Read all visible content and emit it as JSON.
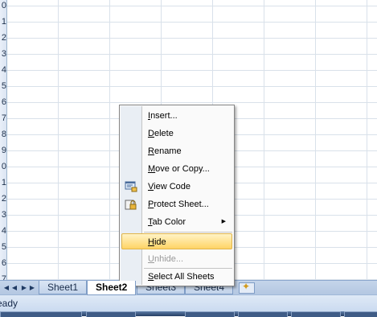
{
  "rows": [
    "0",
    "1",
    "2",
    "3",
    "4",
    "5",
    "6",
    "7",
    "8",
    "9",
    "0",
    "1",
    "2",
    "3",
    "4",
    "5",
    "6",
    "7"
  ],
  "context_menu": {
    "items": [
      {
        "pre": "",
        "u": "I",
        "post": "nsert...",
        "disabled": false
      },
      {
        "pre": "",
        "u": "D",
        "post": "elete",
        "disabled": false
      },
      {
        "pre": "",
        "u": "R",
        "post": "ename",
        "disabled": false
      },
      {
        "pre": "",
        "u": "M",
        "post": "ove or Copy...",
        "disabled": false
      },
      {
        "pre": "",
        "u": "V",
        "post": "iew Code",
        "icon": "view-code-icon",
        "disabled": false
      },
      {
        "pre": "",
        "u": "P",
        "post": "rotect Sheet...",
        "icon": "protect-sheet-icon",
        "disabled": false
      },
      {
        "pre": "",
        "u": "T",
        "post": "ab Color",
        "submenu": true,
        "disabled": false
      },
      {
        "pre": "",
        "u": "H",
        "post": "ide",
        "highlighted": true,
        "disabled": false
      },
      {
        "pre": "",
        "u": "U",
        "post": "nhide...",
        "disabled": true
      },
      {
        "pre": "",
        "u": "S",
        "post": "elect All Sheets",
        "disabled": false
      }
    ]
  },
  "sheet_tabs": {
    "nav": [
      "◀◀",
      "◀",
      "▶",
      "▶▶"
    ],
    "tabs": [
      {
        "label": "Sheet1",
        "active": false
      },
      {
        "label": "Sheet2",
        "active": true
      },
      {
        "label": "Sheet3",
        "active": false
      },
      {
        "label": "Sheet4",
        "active": false
      }
    ]
  },
  "status_bar": {
    "text": "eady"
  },
  "colors": {
    "highlight": "#ffd466",
    "grid": "#d9e1ea",
    "tabbar": "#c5d5ea"
  }
}
